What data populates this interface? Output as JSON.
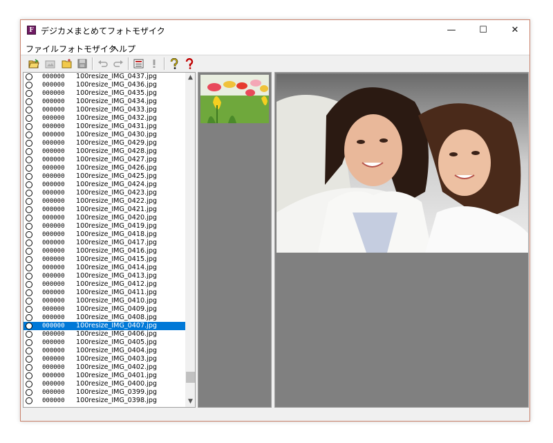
{
  "window": {
    "title": "デジカメまとめてフォトモザイク",
    "app_icon_letter": "F",
    "controls": {
      "minimize": "—",
      "maximize": "☐",
      "close": "✕"
    }
  },
  "menu": [
    "ファイル",
    "フォトモザイク",
    "ヘルプ"
  ],
  "toolbar": {
    "buttons": [
      "open-folder-icon",
      "open-image-icon",
      "new-folder-icon",
      "save-icon",
      "undo-icon",
      "redo-icon",
      "list-icon",
      "exclamation-icon",
      "help-icon",
      "context-help-icon"
    ]
  },
  "file_list": {
    "rows": [
      {
        "num": "000000",
        "name": "100resize_IMG_0437.jpg"
      },
      {
        "num": "000000",
        "name": "100resize_IMG_0436.jpg"
      },
      {
        "num": "000000",
        "name": "100resize_IMG_0435.jpg"
      },
      {
        "num": "000000",
        "name": "100resize_IMG_0434.jpg"
      },
      {
        "num": "000000",
        "name": "100resize_IMG_0433.jpg"
      },
      {
        "num": "000000",
        "name": "100resize_IMG_0432.jpg"
      },
      {
        "num": "000000",
        "name": "100resize_IMG_0431.jpg"
      },
      {
        "num": "000000",
        "name": "100resize_IMG_0430.jpg"
      },
      {
        "num": "000000",
        "name": "100resize_IMG_0429.jpg"
      },
      {
        "num": "000000",
        "name": "100resize_IMG_0428.jpg"
      },
      {
        "num": "000000",
        "name": "100resize_IMG_0427.jpg"
      },
      {
        "num": "000000",
        "name": "100resize_IMG_0426.jpg"
      },
      {
        "num": "000000",
        "name": "100resize_IMG_0425.jpg"
      },
      {
        "num": "000000",
        "name": "100resize_IMG_0424.jpg"
      },
      {
        "num": "000000",
        "name": "100resize_IMG_0423.jpg"
      },
      {
        "num": "000000",
        "name": "100resize_IMG_0422.jpg"
      },
      {
        "num": "000000",
        "name": "100resize_IMG_0421.jpg"
      },
      {
        "num": "000000",
        "name": "100resize_IMG_0420.jpg"
      },
      {
        "num": "000000",
        "name": "100resize_IMG_0419.jpg"
      },
      {
        "num": "000000",
        "name": "100resize_IMG_0418.jpg"
      },
      {
        "num": "000000",
        "name": "100resize_IMG_0417.jpg"
      },
      {
        "num": "000000",
        "name": "100resize_IMG_0416.jpg"
      },
      {
        "num": "000000",
        "name": "100resize_IMG_0415.jpg"
      },
      {
        "num": "000000",
        "name": "100resize_IMG_0414.jpg"
      },
      {
        "num": "000000",
        "name": "100resize_IMG_0413.jpg"
      },
      {
        "num": "000000",
        "name": "100resize_IMG_0412.jpg"
      },
      {
        "num": "000000",
        "name": "100resize_IMG_0411.jpg"
      },
      {
        "num": "000000",
        "name": "100resize_IMG_0410.jpg"
      },
      {
        "num": "000000",
        "name": "100resize_IMG_0409.jpg"
      },
      {
        "num": "000000",
        "name": "100resize_IMG_0408.jpg"
      },
      {
        "num": "000000",
        "name": "100resize_IMG_0407.jpg",
        "selected": true
      },
      {
        "num": "000000",
        "name": "100resize_IMG_0406.jpg"
      },
      {
        "num": "000000",
        "name": "100resize_IMG_0405.jpg"
      },
      {
        "num": "000000",
        "name": "100resize_IMG_0404.jpg"
      },
      {
        "num": "000000",
        "name": "100resize_IMG_0403.jpg"
      },
      {
        "num": "000000",
        "name": "100resize_IMG_0402.jpg"
      },
      {
        "num": "000000",
        "name": "100resize_IMG_0401.jpg"
      },
      {
        "num": "000000",
        "name": "100resize_IMG_0400.jpg"
      },
      {
        "num": "000000",
        "name": "100resize_IMG_0399.jpg"
      },
      {
        "num": "000000",
        "name": "100resize_IMG_0398.jpg"
      }
    ],
    "selected_color": "#0078d7"
  },
  "colors": {
    "panel_gray": "#808080",
    "window_border": "#c8806a",
    "app_icon_bg": "#6f1a63"
  }
}
